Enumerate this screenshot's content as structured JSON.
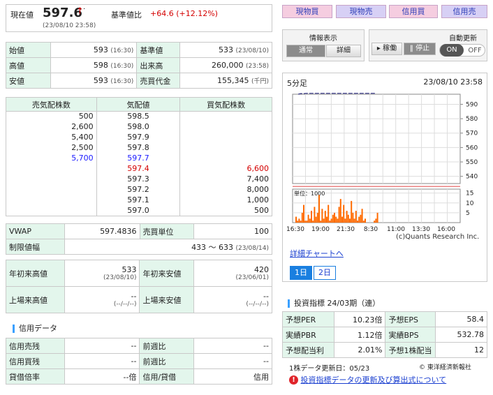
{
  "price": {
    "label": "現在値",
    "value": "597.6",
    "arrow": "↑",
    "dot": "·",
    "time": "(23/08/10 23:58)",
    "base_label": "基準値比",
    "change": "+64.6 (+12.12%)"
  },
  "tabs": {
    "buy": "現物買",
    "sell": "現物売",
    "margin_buy": "信用買",
    "margin_sell": "信用売"
  },
  "info": {
    "title": "情報表示",
    "normal": "通常",
    "detail": "詳細"
  },
  "auto": {
    "title": "自動更新",
    "run": "▸ 稼働",
    "stop": "‖ 停止",
    "on": "ON",
    "off": "OFF"
  },
  "ohlc": {
    "open": {
      "label": "始値",
      "value": "593",
      "time": "(16:30)"
    },
    "high": {
      "label": "高値",
      "value": "598",
      "time": "(16:30)"
    },
    "low": {
      "label": "安値",
      "value": "593",
      "time": "(16:30)"
    },
    "base": {
      "label": "基準値",
      "value": "533",
      "time": "(23/08/10)"
    },
    "volume": {
      "label": "出来高",
      "value": "260,000",
      "time": "(23:58)"
    },
    "turnover": {
      "label": "売買代金",
      "value": "155,345",
      "time": "(千円)"
    }
  },
  "board": {
    "headers": [
      "売気配株数",
      "気配値",
      "買気配株数"
    ],
    "rows": [
      {
        "sell": "500",
        "price": "598.5",
        "buy": ""
      },
      {
        "sell": "2,600",
        "price": "598.0",
        "buy": ""
      },
      {
        "sell": "5,400",
        "price": "597.9",
        "buy": ""
      },
      {
        "sell": "2,500",
        "price": "597.8",
        "buy": ""
      },
      {
        "sell": "5,700",
        "price": "597.7",
        "buy": ""
      },
      {
        "sell": "",
        "price": "597.4",
        "buy": "6,600"
      },
      {
        "sell": "",
        "price": "597.3",
        "buy": "7,400"
      },
      {
        "sell": "",
        "price": "597.2",
        "buy": "8,000"
      },
      {
        "sell": "",
        "price": "597.1",
        "buy": "1,000"
      },
      {
        "sell": "",
        "price": "597.0",
        "buy": "500"
      }
    ]
  },
  "vwap": {
    "label": "VWAP",
    "value": "597.4836",
    "unit_label": "売買単位",
    "unit": "100",
    "limit_label": "制限値幅",
    "limit": "433 〜 633",
    "limit_date": "(23/08/14)"
  },
  "year": {
    "ytd_high_label": "年初来高値",
    "ytd_high": "533",
    "ytd_high_date": "(23/08/10)",
    "ytd_low_label": "年初来安値",
    "ytd_low": "420",
    "ytd_low_date": "(23/06/01)",
    "ipo_high_label": "上場来高値",
    "ipo_high": "--",
    "ipo_high_date": "(--/--/--)",
    "ipo_low_label": "上場来安値",
    "ipo_low": "--",
    "ipo_low_date": "(--/--/--)"
  },
  "margin": {
    "title": "信用データ",
    "rows": [
      {
        "l1": "信用売残",
        "v1": "--",
        "l2": "前週比",
        "v2": "--"
      },
      {
        "l1": "信用買残",
        "v1": "--",
        "l2": "前週比",
        "v2": "--"
      },
      {
        "l1": "貸借倍率",
        "v1": "--倍",
        "l2": "信用/貸借",
        "v2": "信用"
      }
    ]
  },
  "chart_header": {
    "interval": "5分足",
    "datetime": "23/08/10 23:58",
    "unit": "単位：1000",
    "credit": "(c)Quants Research Inc."
  },
  "chart_data": [
    {
      "type": "line",
      "title": "5分足",
      "x_ticks": [
        "16:30",
        "19:00",
        "21:30",
        "8:30",
        "11:00",
        "13:30",
        "16:00"
      ],
      "y_ticks": [
        540,
        550,
        560,
        570,
        580,
        590
      ],
      "ylim": [
        535,
        597
      ],
      "series": [
        {
          "values": [
            597,
            597.5,
            597.4,
            597.6,
            597.6,
            597.6,
            597.6,
            597.6,
            597.6,
            597.6,
            597.6,
            597.6,
            597.6,
            597.6,
            597.6,
            597.6,
            597.6,
            597.6,
            597.6,
            597.6,
            597.6,
            597.6,
            597.6,
            597.6,
            597.6,
            597.6,
            597.6,
            597.6,
            597.6,
            597.6
          ]
        }
      ],
      "base": 533
    },
    {
      "type": "bar",
      "ylabel": "単位：1000",
      "y_ticks": [
        5,
        10,
        15
      ],
      "ylim": [
        0,
        17
      ],
      "values": [
        3,
        1,
        2,
        1,
        5,
        9,
        1,
        1,
        4,
        2,
        6,
        1,
        8,
        3,
        5,
        14,
        1,
        7,
        2,
        6,
        3,
        9,
        1,
        2,
        4,
        5,
        3,
        2,
        8,
        12,
        3,
        9,
        2,
        6,
        4,
        2,
        11,
        5,
        2,
        6,
        1,
        3,
        4,
        7,
        1,
        2,
        0,
        0,
        0,
        0,
        0,
        1,
        2,
        5
      ]
    }
  ],
  "links": {
    "detail_chart": "詳細チャートへ",
    "day1": "1日",
    "day2": "2日"
  },
  "indicators": {
    "title": "投資指標 24/03期（連）",
    "rows": [
      {
        "l1": "予想PER",
        "v1": "10.23倍",
        "l2": "予想EPS",
        "v2": "58.4"
      },
      {
        "l1": "実績PBR",
        "v1": "1.12倍",
        "l2": "実績BPS",
        "v2": "532.78"
      },
      {
        "l1": "予想配当利",
        "v1": "2.01%",
        "l2": "予想1株配当",
        "v2": "12"
      }
    ],
    "update": "1株データ更新日：05/23",
    "source": "© 東洋経済新報社",
    "about_link": "投資指標データの更新及び算出式について"
  }
}
